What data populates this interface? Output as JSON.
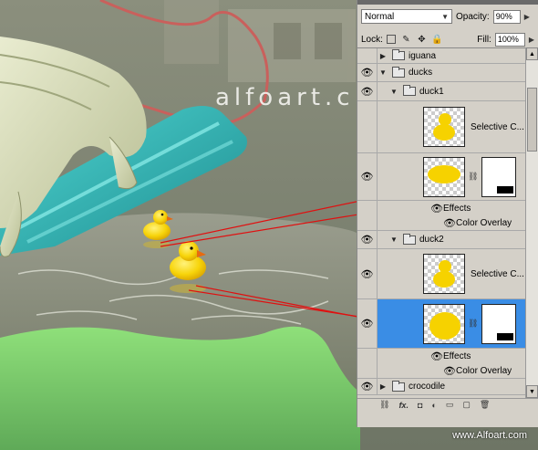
{
  "watermark": "alfoart.c",
  "credit": "www.Alfoart.com",
  "panel": {
    "blend_mode": "Normal",
    "opacity_label": "Opacity:",
    "opacity_value": "90%",
    "lock_label": "Lock:",
    "fill_label": "Fill:",
    "fill_value": "100%",
    "layers": [
      {
        "name": "iguana",
        "type": "group",
        "expanded": false
      },
      {
        "name": "ducks",
        "type": "group",
        "expanded": true
      },
      {
        "name": "duck1",
        "type": "group",
        "expanded": true
      },
      {
        "name": "Selective C...",
        "type": "adjustment"
      },
      {
        "name": "",
        "type": "layer-with-mask"
      },
      {
        "name": "Effects",
        "type": "effects"
      },
      {
        "name": "Color Overlay",
        "type": "effect"
      },
      {
        "name": "duck2",
        "type": "group",
        "expanded": true
      },
      {
        "name": "Selective C...",
        "type": "adjustment"
      },
      {
        "name": "",
        "type": "layer-with-mask",
        "selected": true
      },
      {
        "name": "Effects",
        "type": "effects"
      },
      {
        "name": "Color Overlay",
        "type": "effect"
      },
      {
        "name": "crocodile",
        "type": "group",
        "expanded": false
      }
    ]
  },
  "icons": {
    "eye": "eye-icon",
    "folder": "folder-icon",
    "chain": "link-icon",
    "lock": "lock-icon"
  },
  "colors": {
    "selection": "#3a8de5",
    "annotation_line": "#e01010"
  }
}
